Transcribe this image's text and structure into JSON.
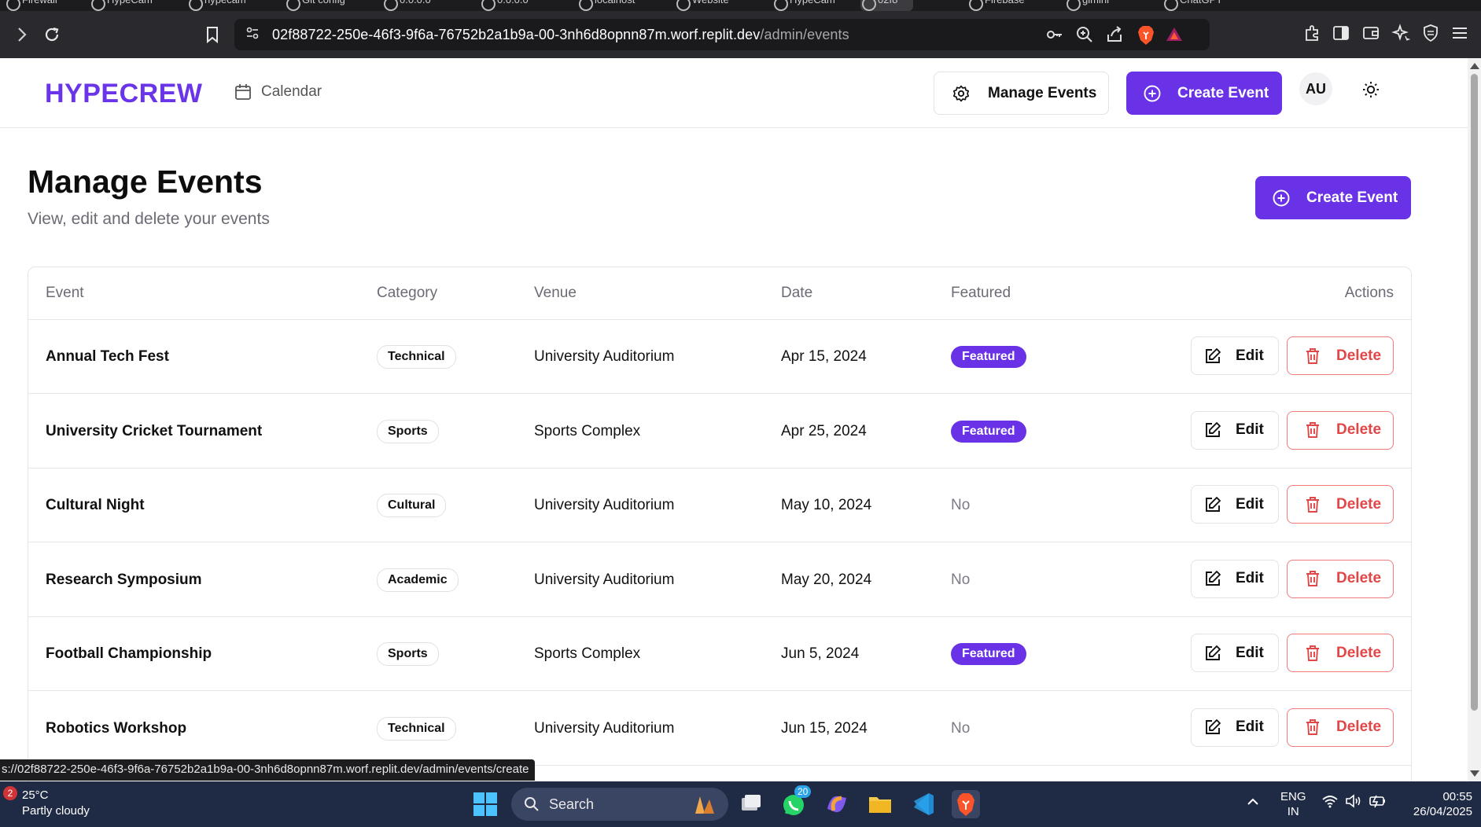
{
  "browser": {
    "tabs": [
      "Firewall",
      "HypeCam",
      "hypecam",
      "Git config",
      "0.0.0.0",
      "0.0.0.0",
      "localhost",
      "Website",
      "HypeCam",
      "02f8",
      "Firebase",
      "gimini",
      "ChatGPT"
    ],
    "url_host": "02f88722-250e-46f3-9f6a-76752b2a1b9a-00-3nh6d8opnn87m.worf.replit.dev",
    "url_path": "/admin/events",
    "status_url": "s://02f88722-250e-46f3-9f6a-76752b2a1b9a-00-3nh6d8opnn87m.worf.replit.dev/admin/events/create"
  },
  "nav": {
    "brand": "HYPECREW",
    "calendar_label": "Calendar",
    "manage_events_label": "Manage Events",
    "create_event_label": "Create Event",
    "avatar_initials": "AU"
  },
  "page": {
    "title": "Manage Events",
    "subtitle": "View, edit and delete your events",
    "create_event_label": "Create Event"
  },
  "table": {
    "headers": {
      "event": "Event",
      "category": "Category",
      "venue": "Venue",
      "date": "Date",
      "featured": "Featured",
      "actions": "Actions"
    },
    "rows": [
      {
        "event": "Annual Tech Fest",
        "category": "Technical",
        "venue": "University Auditorium",
        "date": "Apr 15, 2024",
        "featured": "Featured",
        "is_featured": true
      },
      {
        "event": "University Cricket Tournament",
        "category": "Sports",
        "venue": "Sports Complex",
        "date": "Apr 25, 2024",
        "featured": "Featured",
        "is_featured": true
      },
      {
        "event": "Cultural Night",
        "category": "Cultural",
        "venue": "University Auditorium",
        "date": "May 10, 2024",
        "featured": "No",
        "is_featured": false
      },
      {
        "event": "Research Symposium",
        "category": "Academic",
        "venue": "University Auditorium",
        "date": "May 20, 2024",
        "featured": "No",
        "is_featured": false
      },
      {
        "event": "Football Championship",
        "category": "Sports",
        "venue": "Sports Complex",
        "date": "Jun 5, 2024",
        "featured": "Featured",
        "is_featured": true
      },
      {
        "event": "Robotics Workshop",
        "category": "Technical",
        "venue": "University Auditorium",
        "date": "Jun 15, 2024",
        "featured": "No",
        "is_featured": false
      }
    ],
    "edit_label": "Edit",
    "delete_label": "Delete"
  },
  "taskbar": {
    "weather_badge": "2",
    "temperature": "25°C",
    "weather_desc": "Partly cloudy",
    "search_label": "Search",
    "whatsapp_badge": "20",
    "lang_line1": "ENG",
    "lang_line2": "IN",
    "time": "00:55",
    "date": "26/04/2025"
  },
  "colors": {
    "brand": "#6a35e8",
    "primary_button": "#6a32e6",
    "delete_red": "#e24646"
  }
}
